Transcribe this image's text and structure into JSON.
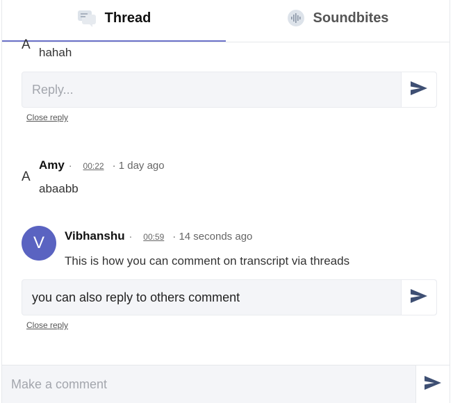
{
  "tabs": [
    {
      "label": "Thread",
      "icon": "chat-bubbles-icon",
      "active": true
    },
    {
      "label": "Soundbites",
      "icon": "soundwave-icon",
      "active": false
    }
  ],
  "thread": {
    "partial_comment": {
      "avatar_letter": "A",
      "text": "hahah",
      "reply_placeholder": "Reply...",
      "reply_value": "",
      "close_reply_label": "Close reply"
    },
    "comments": [
      {
        "avatar_letter": "A",
        "author": "Amy",
        "separator": "·",
        "timestamp": "00:22",
        "ago": "· 1 day ago",
        "text": "abaabb"
      },
      {
        "avatar_letter": "V",
        "avatar_color": "#5a63c1",
        "author": "Vibhanshu",
        "separator": "·",
        "timestamp": "00:59",
        "ago": "· 14 seconds ago",
        "text": "This is how you can comment on transcript via threads",
        "reply_value": "you can also reply to others comment",
        "close_reply_label": "Close reply"
      }
    ]
  },
  "footer": {
    "comment_placeholder": "Make a comment",
    "comment_value": ""
  },
  "colors": {
    "accent": "#6b72c9",
    "send_icon": "#3e4f73"
  }
}
